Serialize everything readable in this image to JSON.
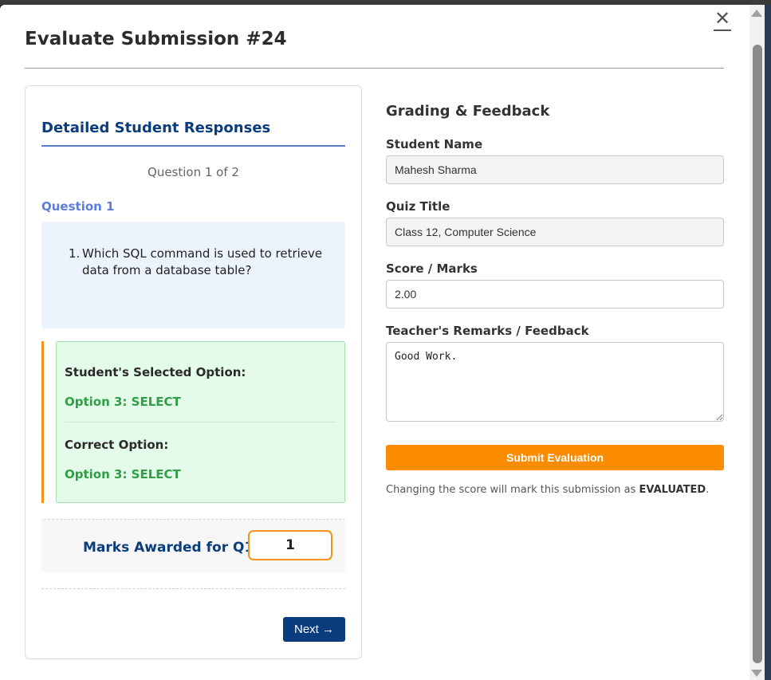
{
  "modal": {
    "title": "Evaluate Submission #24",
    "close_glyph": "✕"
  },
  "left": {
    "heading": "Detailed Student Responses",
    "counter": "Question 1 of 2",
    "question_label": "Question 1",
    "question_number": "1.",
    "question_text": "Which SQL command is used to retrieve data from a database table?",
    "selected_label": "Student's Selected Option:",
    "selected_value": "Option 3: SELECT",
    "correct_label": "Correct Option:",
    "correct_value": "Option 3: SELECT",
    "marks_label": "Marks Awarded for Q1:",
    "marks_value": "1",
    "next_label": "Next →"
  },
  "right": {
    "heading": "Grading & Feedback",
    "student_name_label": "Student Name",
    "student_name_value": "Mahesh Sharma",
    "quiz_title_label": "Quiz Title",
    "quiz_title_value": "Class 12, Computer Science",
    "score_label": "Score / Marks",
    "score_value": "2.00",
    "remarks_label": "Teacher's Remarks / Feedback",
    "remarks_value": "Good Work.",
    "submit_label": "Submit Evaluation",
    "help_prefix": "Changing the score will mark this submission as ",
    "help_status": "EVALUATED",
    "help_suffix": "."
  },
  "colors": {
    "accent_blue": "#0b3c7d",
    "accent_orange": "#fb8c00",
    "success_green": "#2f9e44"
  },
  "icons": {
    "close": "close-icon",
    "scroll_up": "triangle-up-icon",
    "scroll_down": "triangle-down-icon"
  }
}
